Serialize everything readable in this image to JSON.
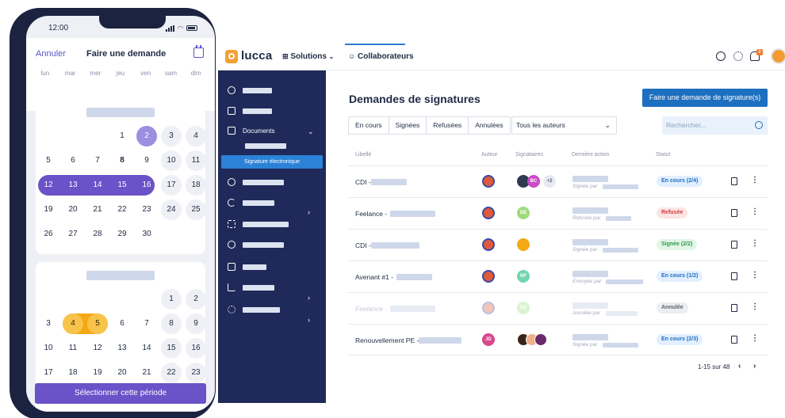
{
  "phone": {
    "status_time": "12:00",
    "cancel_label": "Annuler",
    "title": "Faire une demande",
    "calendar_icon": "calendar-icon",
    "weekdays": [
      "lun",
      "mar",
      "mer",
      "jeu",
      "ven",
      "sam",
      "dim"
    ],
    "month1": {
      "rows": [
        [
          "",
          "",
          "",
          "1",
          "2",
          "3",
          "4"
        ],
        [
          "5",
          "6",
          "7",
          "8",
          "9",
          "10",
          "11"
        ],
        [
          "12",
          "13",
          "14",
          "15",
          "16",
          "17",
          "18"
        ],
        [
          "19",
          "20",
          "21",
          "22",
          "23",
          "24",
          "25"
        ],
        [
          "26",
          "27",
          "28",
          "29",
          "30",
          "",
          ""
        ]
      ]
    },
    "month2": {
      "rows": [
        [
          "",
          "",
          "",
          "",
          "",
          "1",
          "2"
        ],
        [
          "3",
          "4",
          "5",
          "6",
          "7",
          "8",
          "9"
        ],
        [
          "10",
          "11",
          "12",
          "13",
          "14",
          "15",
          "16"
        ],
        [
          "17",
          "18",
          "19",
          "20",
          "21",
          "22",
          "23"
        ]
      ]
    },
    "select_button": "Sélectionner cette période",
    "accent_color": "#6a52c8",
    "highlight_color": "#f4a814"
  },
  "topbar": {
    "logo_text": "lucca",
    "nav_solutions": "Solutions",
    "nav_collaborateurs": "Collaborateurs",
    "icons": [
      "help-icon",
      "settings-icon",
      "bell-icon"
    ],
    "bell_badge": "8"
  },
  "sidebar": {
    "documents_label": "Documents",
    "active_item": "Signature électronique",
    "icons": [
      "user-icon",
      "id-card-icon",
      "clipboard-icon",
      "user-add-icon",
      "refresh-icon",
      "list-icon",
      "user-check-icon",
      "external-link-icon",
      "chart-icon",
      "gear-icon"
    ]
  },
  "main": {
    "title": "Demandes de signatures",
    "primary_button": "Faire une demande de signature(s)",
    "tabs": [
      "En cours",
      "Signées",
      "Refusées",
      "Annulées"
    ],
    "authors_select": "Tous les auteurs",
    "search_placeholder": "Rechercher...",
    "columns": [
      "Libellé",
      "Auteur",
      "Signataires",
      "Dernière action",
      "Statut"
    ],
    "rows": [
      {
        "label": "CDI -",
        "signers_extra": "+2",
        "signer_initials": [
          "",
          "BC"
        ],
        "last_action": "Signée par",
        "status": "En cours (2/4)"
      },
      {
        "label": "Feelance -",
        "signer_initials": [
          "DE"
        ],
        "last_action": "Refusée par",
        "status": "Refusée"
      },
      {
        "label": "CDI -",
        "signer_initials": [
          ""
        ],
        "last_action": "Signée par",
        "status": "Signée (2/2)"
      },
      {
        "label": "Avenant #1 -",
        "signer_initials": [
          "NF"
        ],
        "last_action": "Envoyée par",
        "status": "En cours (1/2)"
      },
      {
        "label": "Feelance -",
        "signer_initials": [
          "DE"
        ],
        "last_action": "Annulée par",
        "status": "Annulée"
      },
      {
        "label": "Renouvellement PE -",
        "author_initials": "JD",
        "signer_initials": [
          "",
          "",
          ""
        ],
        "last_action": "Signée par",
        "status": "En cours (2/3)"
      }
    ],
    "pagination": "1-15 sur 48"
  }
}
